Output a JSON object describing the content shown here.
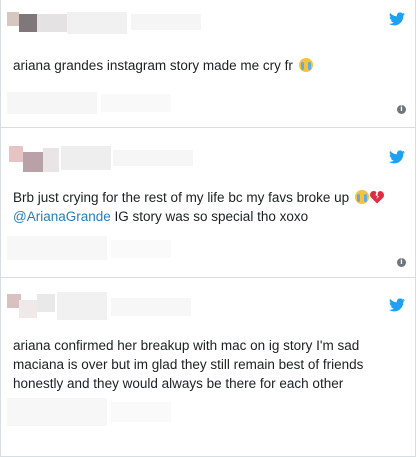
{
  "tweets": [
    {
      "text": "ariana grandes instagram story made me cry fr",
      "emoji": "loudly-crying-face"
    },
    {
      "line1": "Brb just crying for the rest of my life bc my favs broke up",
      "emojis": [
        "loudly-crying-face",
        "broken-heart"
      ],
      "mention": "@ArianaGrande",
      "line2": " IG story was so special tho xoxo"
    },
    {
      "line1": "ariana confirmed her breakup with mac on ig story I'm sad",
      "line2": "maciana is over but im glad they still remain best of friends",
      "line3": "honestly and they would always be there for each other"
    }
  ],
  "icons": {
    "brand": "twitter-icon",
    "info": "info-icon"
  },
  "colors": {
    "twitter_blue": "#1da1f2",
    "mention": "#2b7bb9",
    "text": "#1c2022",
    "border": "#d8dde1"
  }
}
